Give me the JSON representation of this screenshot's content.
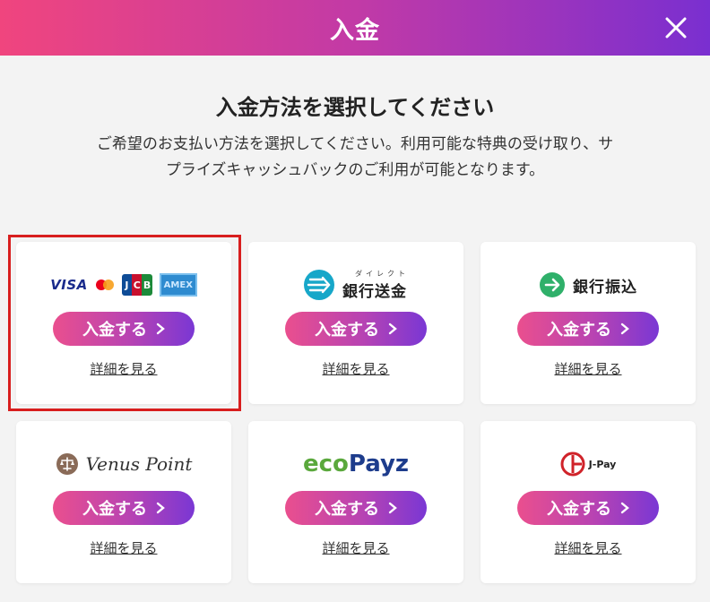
{
  "header": {
    "title": "入金"
  },
  "heading": "入金方法を選択してください",
  "description": "ご希望のお支払い方法を選択してください。利用可能な特典の受け取り、サプライズキャッシュバックのご利用が可能となります。",
  "button_label": "入金する",
  "detail_label": "詳細を見る",
  "methods": [
    {
      "logo_texts": [
        "VISA",
        "JCB",
        "AMEX"
      ]
    },
    {
      "logo_texts": [
        "ダイレクト",
        "銀行送金"
      ]
    },
    {
      "logo_texts": [
        "銀行振込"
      ]
    },
    {
      "logo_texts": [
        "Venus Point"
      ]
    },
    {
      "logo_texts": [
        "eco",
        "Payz"
      ]
    },
    {
      "logo_texts": [
        "J-Pay"
      ]
    }
  ],
  "colors": {
    "header_gradient": [
      "#f0457e",
      "#7a2fd0"
    ],
    "button_gradient": [
      "#ea4f8e",
      "#7a37d4"
    ],
    "highlight": "#d81e1e",
    "eco_green": "#5aa83c",
    "eco_blue": "#1d3c8c"
  },
  "icons": [
    "close-icon",
    "chevron-right-icon",
    "mastercard-icon",
    "direct-transfer-icon",
    "arrow-circle-icon",
    "venus-scales-icon",
    "jpay-icon"
  ]
}
